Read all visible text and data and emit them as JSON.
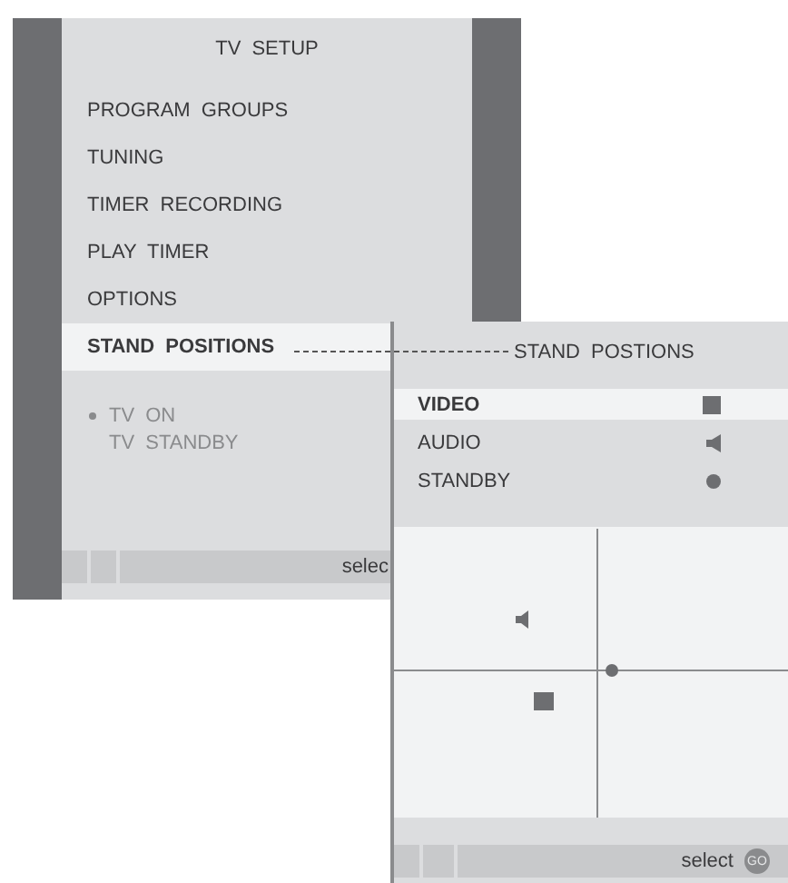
{
  "main_menu": {
    "title": "TV SETUP",
    "items": [
      {
        "label": "PROGRAM GROUPS",
        "selected": false
      },
      {
        "label": "TUNING",
        "selected": false
      },
      {
        "label": "TIMER RECORDING",
        "selected": false
      },
      {
        "label": "PLAY TIMER",
        "selected": false
      },
      {
        "label": "OPTIONS",
        "selected": false
      },
      {
        "label": "STAND POSITIONS",
        "selected": true
      }
    ],
    "options": [
      {
        "label": "TV ON",
        "selected": true
      },
      {
        "label": "TV STANDBY",
        "selected": false
      }
    ],
    "footer": "selec"
  },
  "submenu": {
    "title": "STAND POSTIONS",
    "items": [
      {
        "label": "VIDEO",
        "kind": "video",
        "selected": true
      },
      {
        "label": "AUDIO",
        "kind": "audio",
        "selected": false
      },
      {
        "label": "STANDBY",
        "kind": "standby",
        "selected": false
      }
    ],
    "footer": "select",
    "go_key": "GO"
  }
}
